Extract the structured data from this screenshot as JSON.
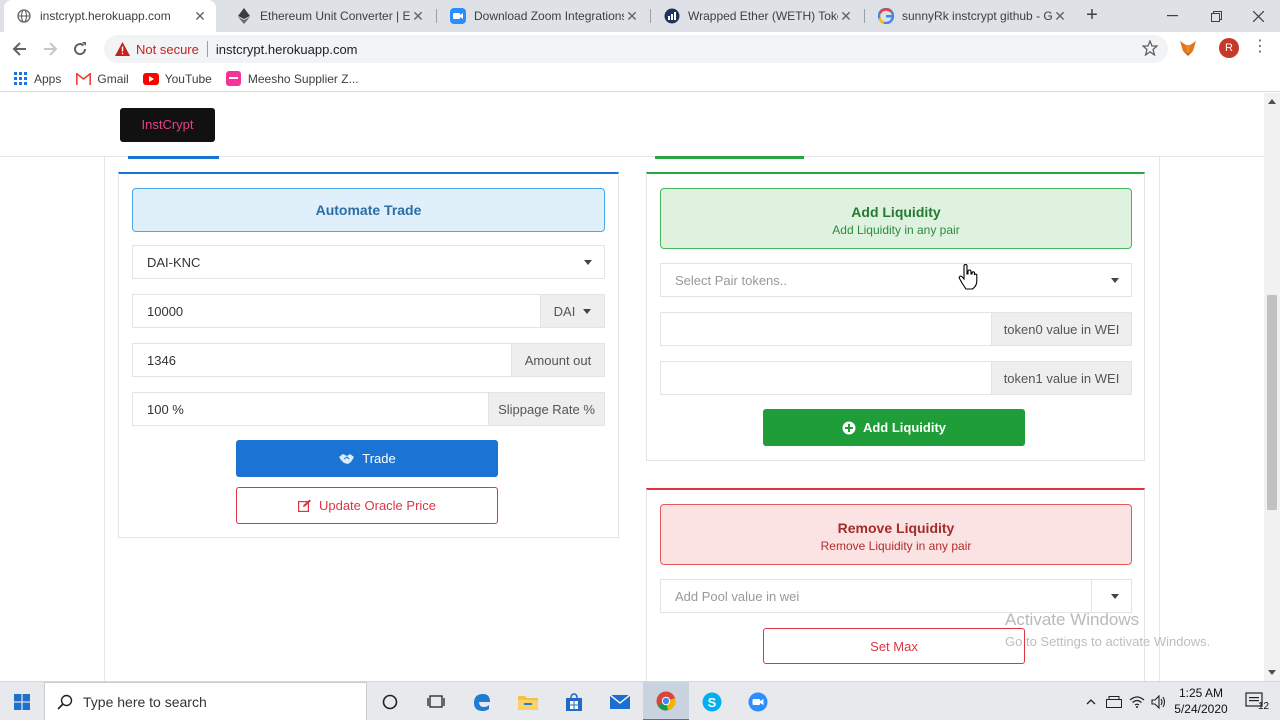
{
  "browser": {
    "tabs": [
      {
        "title": "instcrypt.herokuapp.com",
        "active": true
      },
      {
        "title": "Ethereum Unit Converter | Eth",
        "active": false
      },
      {
        "title": "Download Zoom Integrations",
        "active": false
      },
      {
        "title": "Wrapped Ether (WETH) Token",
        "active": false
      },
      {
        "title": "sunnyRk instcrypt github - Go",
        "active": false
      }
    ],
    "security_label": "Not secure",
    "url": "instcrypt.herokuapp.com",
    "profile_initial": "R",
    "bookmarks": [
      {
        "label": "Apps",
        "icon": "apps-grid-icon"
      },
      {
        "label": "Gmail",
        "icon": "gmail-icon"
      },
      {
        "label": "YouTube",
        "icon": "youtube-icon"
      },
      {
        "label": "Meesho Supplier Z...",
        "icon": "meesho-icon"
      }
    ]
  },
  "app": {
    "brand": "InstCrypt",
    "trade": {
      "title": "Automate Trade",
      "pair": "DAI-KNC",
      "amount_in": "10000",
      "token_in": "DAI",
      "amount_out": "1346",
      "amount_out_label": "Amount out",
      "slippage": "100 %",
      "slippage_label": "Slippage Rate %",
      "trade_button": "Trade",
      "oracle_button": "Update Oracle Price"
    },
    "add_liquidity": {
      "title": "Add Liquidity",
      "subtitle": "Add Liquidity in any pair",
      "pair_placeholder": "Select Pair tokens..",
      "token0_label": "token0 value in WEI",
      "token1_label": "token1 value in WEI",
      "button": "Add Liquidity"
    },
    "remove_liquidity": {
      "title": "Remove Liquidity",
      "subtitle": "Remove Liquidity in any pair",
      "pool_placeholder": "Add Pool value in wei",
      "set_max_button": "Set Max"
    },
    "watermark": {
      "line1": "Activate Windows",
      "line2": "Go to Settings to activate Windows."
    }
  },
  "taskbar": {
    "search_placeholder": "Type here to search",
    "time": "1:25 AM",
    "date": "5/24/2020",
    "notification_count": "12"
  },
  "colors": {
    "primary": "#1b74d4",
    "success": "#28a745",
    "danger": "#dc3545",
    "brand_text": "#e83e8c"
  }
}
